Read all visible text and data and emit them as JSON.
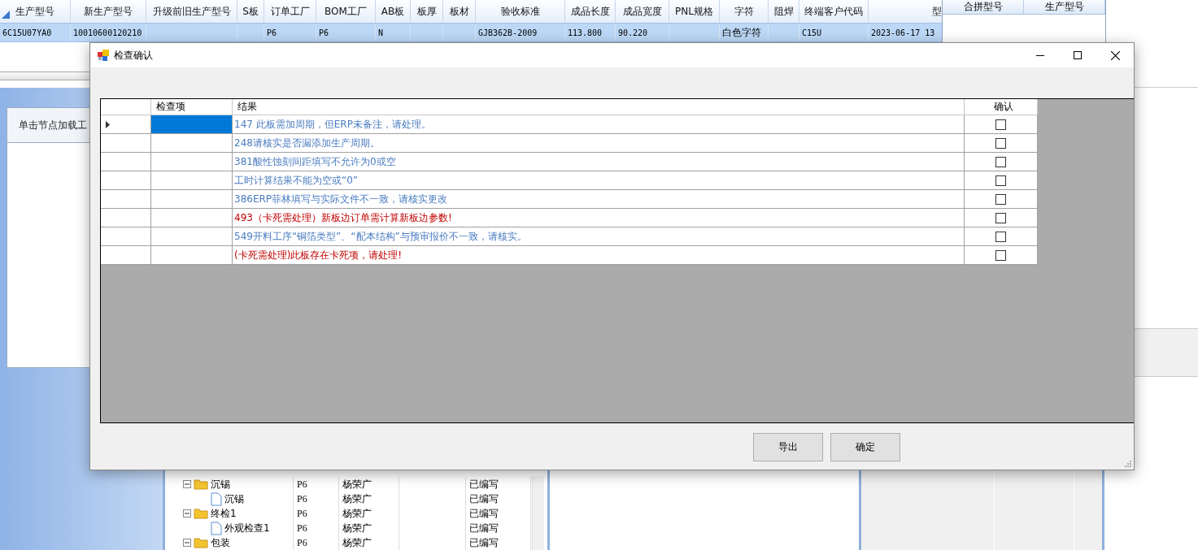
{
  "main_grid": {
    "columns": [
      "生产型号",
      "新生产型号",
      "升级前旧生产型号",
      "S板",
      "订单工厂",
      "BOM工厂",
      "AB板",
      "板厚",
      "板材",
      "验收标准",
      "成品长度",
      "成品宽度",
      "PNL规格",
      "字符",
      "阻焊",
      "终端客户代码",
      "型"
    ],
    "rows": [
      {
        "selected": true,
        "cells": [
          "6C15U07YA0",
          "10010600120210",
          "",
          "",
          "P6",
          "P6",
          "N",
          "",
          "",
          "GJB362B-2009",
          "113.800",
          "90.220",
          "",
          "白色字符",
          "",
          "C15U",
          "2023-06-17 13"
        ]
      }
    ]
  },
  "merge_panel": {
    "columns": [
      "合拼型号",
      "生产型号"
    ]
  },
  "left_panel": {
    "hint": "单击节点加载工"
  },
  "process_tree": {
    "items": [
      {
        "name": "沉锡",
        "factory": "P6",
        "person": "杨荣广",
        "status": "已编写",
        "expanded": true,
        "children": [
          {
            "name": "沉锡",
            "factory": "P6",
            "person": "杨荣广",
            "status": "已编写"
          }
        ]
      },
      {
        "name": "终检1",
        "factory": "P6",
        "person": "杨荣广",
        "status": "已编写",
        "expanded": true,
        "children": [
          {
            "name": "外观检查1",
            "factory": "P6",
            "person": "杨荣广",
            "status": "已编写"
          }
        ]
      },
      {
        "name": "包装",
        "factory": "P6",
        "person": "杨荣广",
        "status": "已编写",
        "expanded": true
      }
    ]
  },
  "dialog": {
    "title": "检查确认",
    "columns": [
      "检查项",
      "结果",
      "确认"
    ],
    "rows": [
      {
        "result": "147 此板需加周期，但ERP未备注，请处理。",
        "kind": "warning",
        "checked": false,
        "selected": true
      },
      {
        "result": "248请核实是否漏添加生产周期。",
        "kind": "warning",
        "checked": false,
        "selected": false
      },
      {
        "result": "381酸性蚀刻间距填写不允许为0或空",
        "kind": "warning",
        "checked": false,
        "selected": false
      },
      {
        "result": "工时计算结果不能为空或“0”",
        "kind": "warning",
        "checked": false,
        "selected": false
      },
      {
        "result": "386ERP菲林填写与实际文件不一致，请核实更改",
        "kind": "warning",
        "checked": false,
        "selected": false
      },
      {
        "result": "493（卡死需处理）新板边订单需计算新板边参数!",
        "kind": "critical",
        "checked": false,
        "selected": false
      },
      {
        "result": "549开料工序“铜箔类型”、“配本结构”与预审报价不一致，请核实。",
        "kind": "warning",
        "checked": false,
        "selected": false
      },
      {
        "result": "(卡死需处理)此板存在卡死项，请处理!",
        "kind": "critical",
        "checked": false,
        "selected": false
      }
    ],
    "buttons": [
      "导出",
      "确定"
    ]
  }
}
